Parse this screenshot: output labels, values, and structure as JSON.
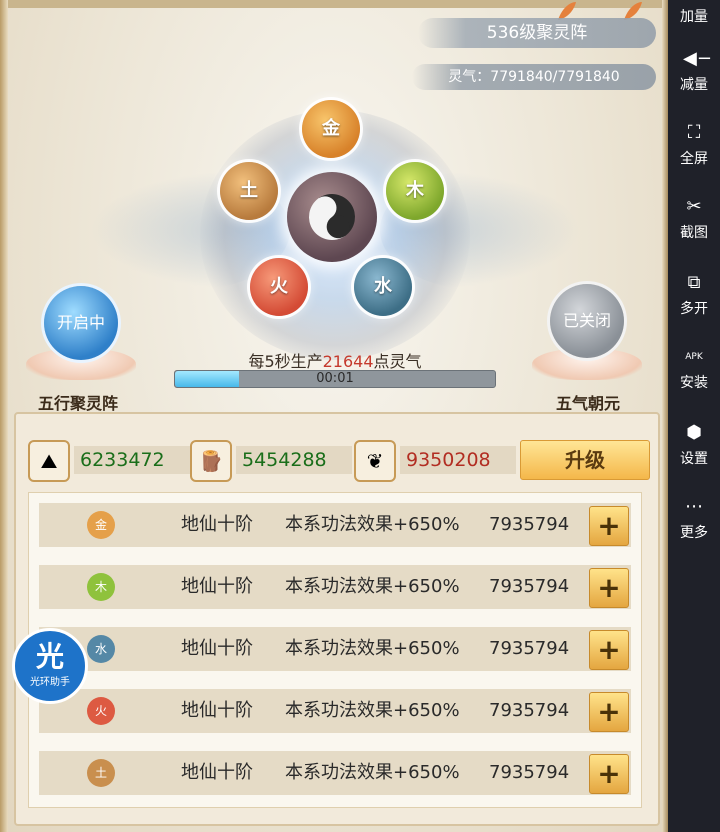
{
  "header": {
    "title": "536级聚灵阵",
    "energy": "灵气：7791840/7791840"
  },
  "array": {
    "elements": [
      "金",
      "木",
      "水",
      "火",
      "土"
    ],
    "left_button": "开启中",
    "left_label": "五行聚灵阵",
    "right_button": "已关闭",
    "right_label": "五气朝元",
    "production_prefix": "每5秒生产",
    "production_value": "21644",
    "production_suffix": "点灵气",
    "timer": "00:01",
    "progress_fraction": 0.2
  },
  "resources": [
    {
      "value": "6233472",
      "color": "green"
    },
    {
      "value": "5454288",
      "color": "green"
    },
    {
      "value": "9350208",
      "color": "red"
    }
  ],
  "upgrade_label": "升级",
  "rows": [
    {
      "element": "金",
      "rank": "地仙十阶",
      "effect": "本系功法效果+650%",
      "value": "7935794"
    },
    {
      "element": "木",
      "rank": "地仙十阶",
      "effect": "本系功法效果+650%",
      "value": "7935794"
    },
    {
      "element": "水",
      "rank": "地仙十阶",
      "effect": "本系功法效果+650%",
      "value": "7935794"
    },
    {
      "element": "火",
      "rank": "地仙十阶",
      "effect": "本系功法效果+650%",
      "value": "7935794"
    },
    {
      "element": "土",
      "rank": "地仙十阶",
      "effect": "本系功法效果+650%",
      "value": "7935794"
    }
  ],
  "plus_label": "+",
  "assistant": {
    "big": "光",
    "small": "光环助手"
  },
  "sidebar": [
    {
      "label": "加量",
      "icon": "volume-up-icon"
    },
    {
      "label": "减量",
      "icon": "volume-down-icon"
    },
    {
      "label": "全屏",
      "icon": "fullscreen-icon"
    },
    {
      "label": "截图",
      "icon": "scissors-icon"
    },
    {
      "label": "多开",
      "icon": "multi-window-icon"
    },
    {
      "label": "安装",
      "icon": "apk-icon"
    },
    {
      "label": "设置",
      "icon": "settings-icon"
    },
    {
      "label": "更多",
      "icon": "more-icon"
    }
  ],
  "colors": {
    "red_value": "#b22d22",
    "green_value": "#1a6e1a",
    "sidebar_bg": "#1f2129"
  }
}
